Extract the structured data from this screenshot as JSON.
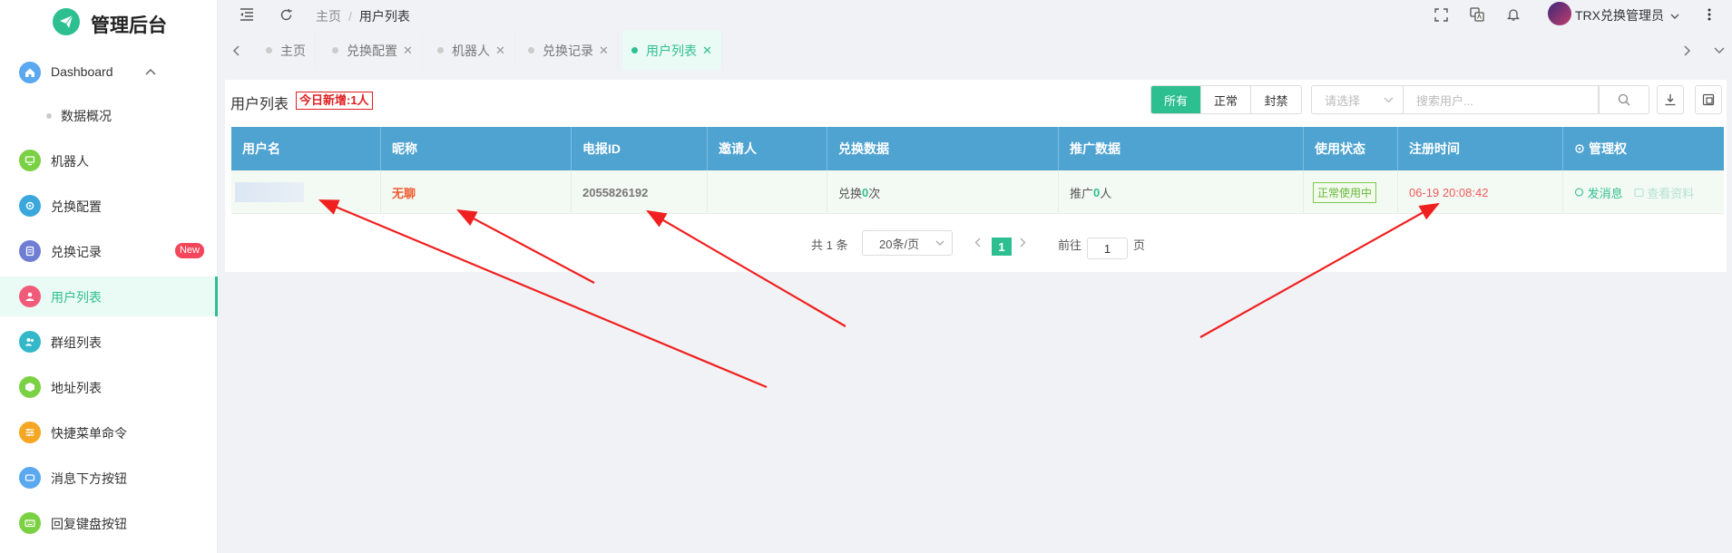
{
  "app": {
    "title": "管理后台"
  },
  "sidebar": {
    "items": [
      {
        "label": "Dashboard",
        "icon": "home-icon",
        "color": "#5aa8f0"
      },
      {
        "label": "数据概况",
        "sub": true
      },
      {
        "label": "机器人",
        "icon": "monitor-icon",
        "color": "#7bd144"
      },
      {
        "label": "兑换配置",
        "icon": "gear-icon",
        "color": "#3aa8dc"
      },
      {
        "label": "兑换记录",
        "icon": "document-icon",
        "color": "#6f7ed4",
        "badge": "New"
      },
      {
        "label": "用户列表",
        "icon": "user-icon",
        "color": "#f05b7a",
        "active": true
      },
      {
        "label": "群组列表",
        "icon": "group-icon",
        "color": "#33b8c9"
      },
      {
        "label": "地址列表",
        "icon": "box-icon",
        "color": "#7bd144"
      },
      {
        "label": "快捷菜单命令",
        "icon": "sliders-icon",
        "color": "#f5a623"
      },
      {
        "label": "消息下方按钮",
        "icon": "rectangle-icon",
        "color": "#5aa8f0"
      },
      {
        "label": "回复键盘按钮",
        "icon": "keyboard-icon",
        "color": "#7bd144"
      }
    ]
  },
  "header": {
    "breadcrumb": {
      "home": "主页",
      "current": "用户列表"
    },
    "user": "TRX兑换管理员"
  },
  "tabs": [
    {
      "label": "主页",
      "closable": false
    },
    {
      "label": "兑换配置",
      "closable": true
    },
    {
      "label": "机器人",
      "closable": true
    },
    {
      "label": "兑换记录",
      "closable": true
    },
    {
      "label": "用户列表",
      "closable": true,
      "active": true
    }
  ],
  "page": {
    "title": "用户列表",
    "new_today": "今日新增:1人",
    "filters": [
      "所有",
      "正常",
      "封禁"
    ],
    "select_placeholder": "请选择",
    "search_placeholder": "搜索用户..."
  },
  "table": {
    "columns": [
      "用户名",
      "昵称",
      "电报ID",
      "邀请人",
      "兑换数据",
      "推广数据",
      "使用状态",
      "注册时间",
      "管理权"
    ],
    "row": {
      "username": "",
      "nickname": "无聊",
      "tg_id": "2055826192",
      "inviter": "",
      "exchange_prefix": "兑换",
      "exchange_count": "0",
      "exchange_suffix": "次",
      "promo_prefix": "推广",
      "promo_count": "0",
      "promo_suffix": "人",
      "status": "正常使用中",
      "reg_time": "06-19 20:08:42",
      "action_message": "发消息",
      "action_profile": "查看资料"
    }
  },
  "pagination": {
    "total": "共 1 条",
    "page_size": "20条/页",
    "current": "1",
    "goto_label": "前往",
    "goto_value": "1",
    "page_suffix": "页"
  }
}
